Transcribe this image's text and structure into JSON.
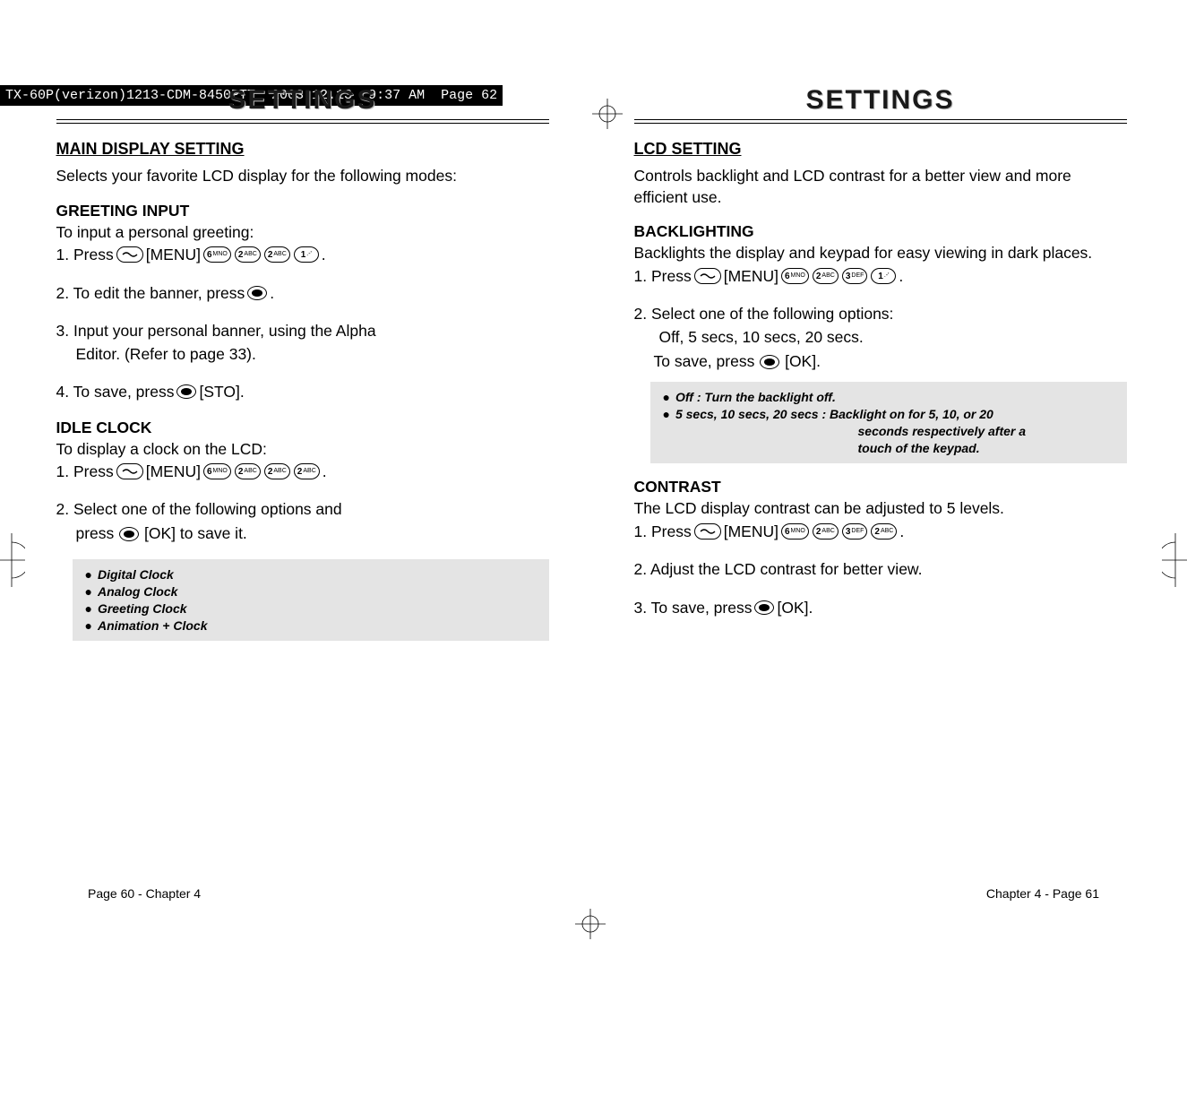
{
  "topBar": "TX-60P(verizon)1213-CDM-8450PTT  2003.12.13  9:37 AM  Page 62",
  "left": {
    "title": "SETTINGS",
    "mainDisplay": {
      "heading": "MAIN DISPLAY SETTING",
      "intro": "Selects your favorite LCD display for the following modes:"
    },
    "greeting": {
      "heading": "GREETING INPUT",
      "lead": "To input a personal greeting:",
      "step1a": "1. Press ",
      "menuLabel": " [MENU] ",
      "step1b": ".",
      "step2a": "2. To edit the banner, press ",
      "step2b": " .",
      "step3": "3. Input your personal banner, using the Alpha",
      "step3b": "Editor. (Refer to page 33).",
      "step4a": "4. To save, press ",
      "step4b": " [STO]."
    },
    "idle": {
      "heading": "IDLE CLOCK",
      "lead": "To display a clock on the LCD:",
      "step1a": "1. Press  ",
      "step1b": ".",
      "step2": "2. Select one of the following options and",
      "step2b": "press ",
      "step2c": " [OK] to save it.",
      "notes": [
        "Digital Clock",
        "Analog Clock",
        "Greeting Clock",
        "Animation + Clock"
      ]
    },
    "footer": "Page 60 - Chapter 4"
  },
  "right": {
    "title": "SETTINGS",
    "lcd": {
      "heading": "LCD SETTING",
      "intro": "Controls backlight and LCD contrast for a better view and more efficient use."
    },
    "backlight": {
      "heading": "BACKLIGHTING",
      "lead": "Backlights the display and keypad for easy viewing in dark places.",
      "step1a": "1. Press  ",
      "step1b": " .",
      "step2a": "2. Select one of the following options:",
      "step2b": "Off, 5 secs, 10 secs, 20 secs.",
      "step2c": "To save, press ",
      "step2d": " [OK].",
      "note1": "Off : Turn the backlight off.",
      "note2": "5 secs, 10 secs, 20 secs : Backlight on for 5, 10, or 20",
      "note2b": "seconds respectively after a",
      "note2c": "touch of the keypad."
    },
    "contrast": {
      "heading": "CONTRAST",
      "lead": "The LCD display contrast can be adjusted to 5 levels.",
      "step1a": "1. Press  ",
      "step1b": ".",
      "step2": "2. Adjust the LCD contrast for better view.",
      "step3a": "3. To save, press ",
      "step3b": " [OK]."
    },
    "footer": "Chapter 4 - Page 61"
  },
  "keys": {
    "menu": " [MENU] ",
    "k6": "6",
    "k6s": "MNO",
    "k2": "2",
    "k2s": "ABC",
    "k3": "3",
    "k3s": "DEF",
    "k1": "1",
    "k1s": ".-'"
  }
}
